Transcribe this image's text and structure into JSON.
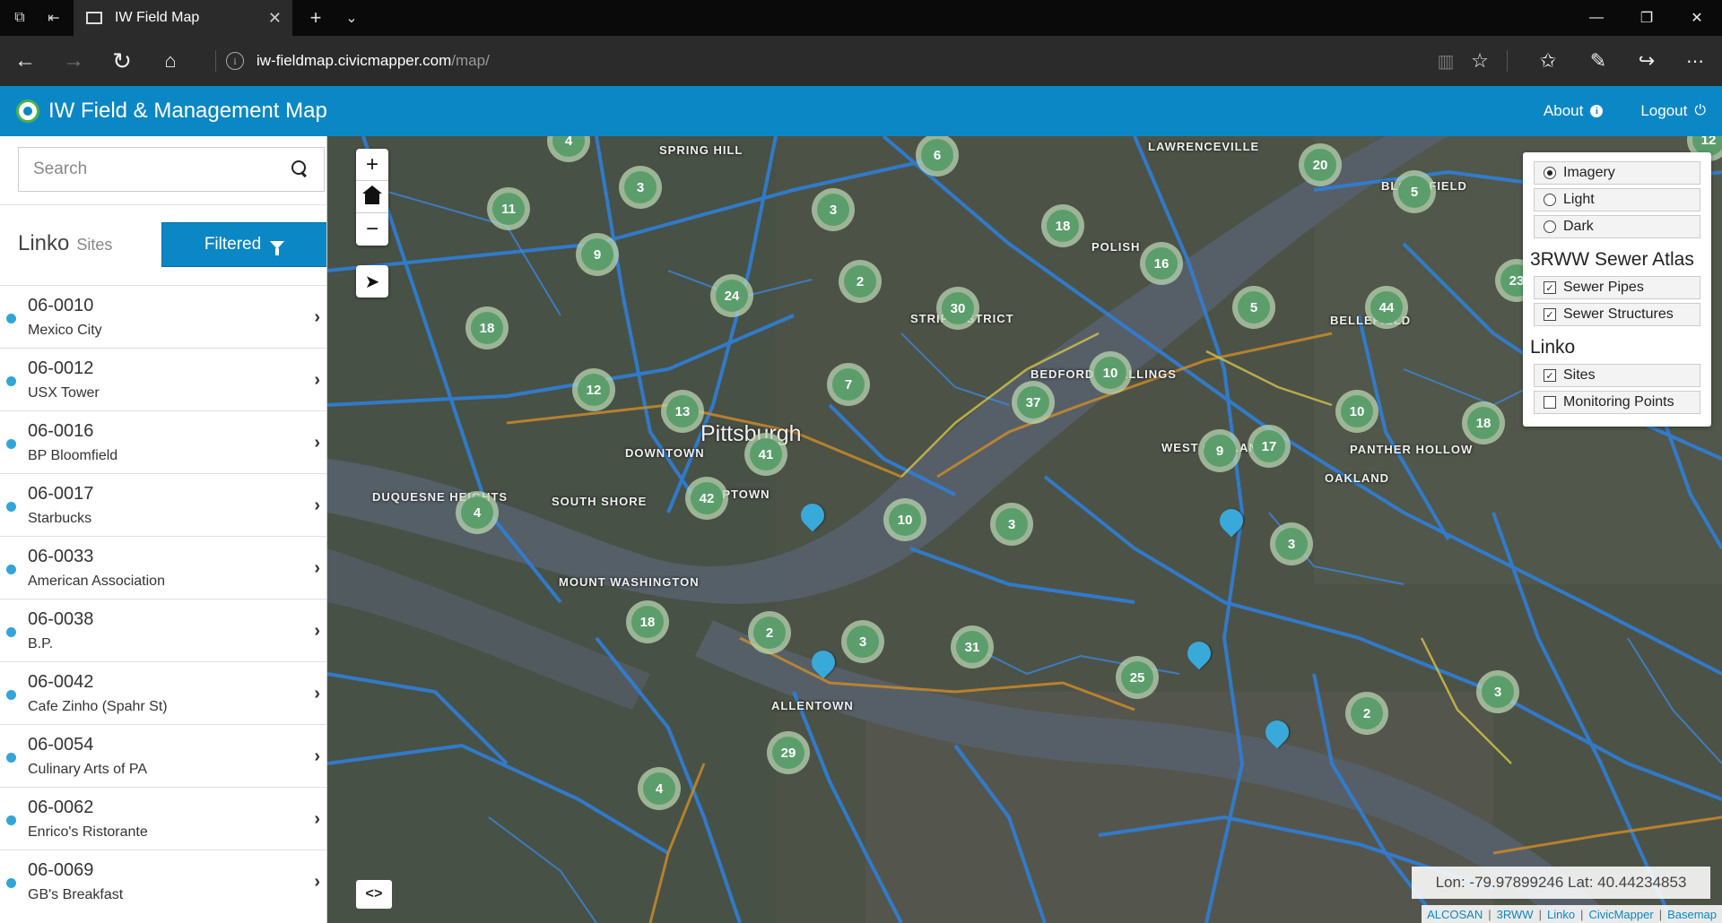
{
  "browser": {
    "tab_title": "IW Field Map",
    "url_host": "iw-fieldmap.civicmapper.com",
    "url_path": "/map/"
  },
  "app": {
    "title": "IW Field & Management Map",
    "about_label": "About",
    "logout_label": "Logout"
  },
  "sidebar": {
    "search_placeholder": "Search",
    "brand": "Linko",
    "brand_sub": "Sites",
    "filter_label": "Filtered",
    "sites": [
      {
        "id": "06-0010",
        "name": "Mexico City"
      },
      {
        "id": "06-0012",
        "name": "USX Tower"
      },
      {
        "id": "06-0016",
        "name": "BP Bloomfield"
      },
      {
        "id": "06-0017",
        "name": "Starbucks"
      },
      {
        "id": "06-0033",
        "name": "American Association"
      },
      {
        "id": "06-0038",
        "name": "B.P."
      },
      {
        "id": "06-0042",
        "name": "Cafe Zinho (Spahr St)"
      },
      {
        "id": "06-0054",
        "name": "Culinary Arts of PA"
      },
      {
        "id": "06-0062",
        "name": "Enrico's Ristorante"
      },
      {
        "id": "06-0069",
        "name": "GB's Breakfast"
      }
    ]
  },
  "map": {
    "labels": {
      "pittsburgh": "Pittsburgh",
      "downtown": "DOWNTOWN",
      "uptown": "UPTOWN",
      "strip_district": "STRIP DISTRICT",
      "bedford_dwellings": "BEDFORD DWELLINGS",
      "south_shore": "SOUTH SHORE",
      "mount_washington": "MOUNT WASHINGTON",
      "bloomfield": "BLOOMFIELD",
      "lawrenceville": "LAWRENCEVILLE",
      "bellefield": "BELLEFIELD",
      "oakland": "OAKLAND",
      "allentown": "ALLENTOWN",
      "polish_hill": "POLISH",
      "spring_hill": "SPRING HILL",
      "duquesne_heights": "DUQUESNE HEIGHTS",
      "west_oakland": "WEST OAKLAND",
      "panther_hollow": "PANTHER HOLLOW"
    },
    "clusters": [
      "4",
      "6",
      "20",
      "5",
      "3",
      "11",
      "3",
      "9",
      "18",
      "16",
      "24",
      "2",
      "30",
      "5",
      "44",
      "18",
      "12",
      "13",
      "7",
      "37",
      "10",
      "10",
      "18",
      "41",
      "42",
      "9",
      "17",
      "4",
      "10",
      "3",
      "3",
      "18",
      "2",
      "3",
      "31",
      "25",
      "2",
      "3",
      "29",
      "4",
      "23",
      "12"
    ],
    "layers": {
      "basemaps": [
        {
          "label": "Imagery",
          "selected": true
        },
        {
          "label": "Light",
          "selected": false
        },
        {
          "label": "Dark",
          "selected": false
        }
      ],
      "group1_title": "3RWW Sewer Atlas",
      "group1": [
        {
          "label": "Sewer Pipes",
          "checked": true
        },
        {
          "label": "Sewer Structures",
          "checked": true
        }
      ],
      "group2_title": "Linko",
      "group2": [
        {
          "label": "Sites",
          "checked": true
        },
        {
          "label": "Monitoring Points",
          "checked": false
        }
      ]
    },
    "coords": "Lon: -79.97899246 Lat: 40.44234853",
    "attribution": [
      "ALCOSAN",
      "3RWW",
      "Linko",
      "CivicMapper",
      "Basemap"
    ]
  }
}
